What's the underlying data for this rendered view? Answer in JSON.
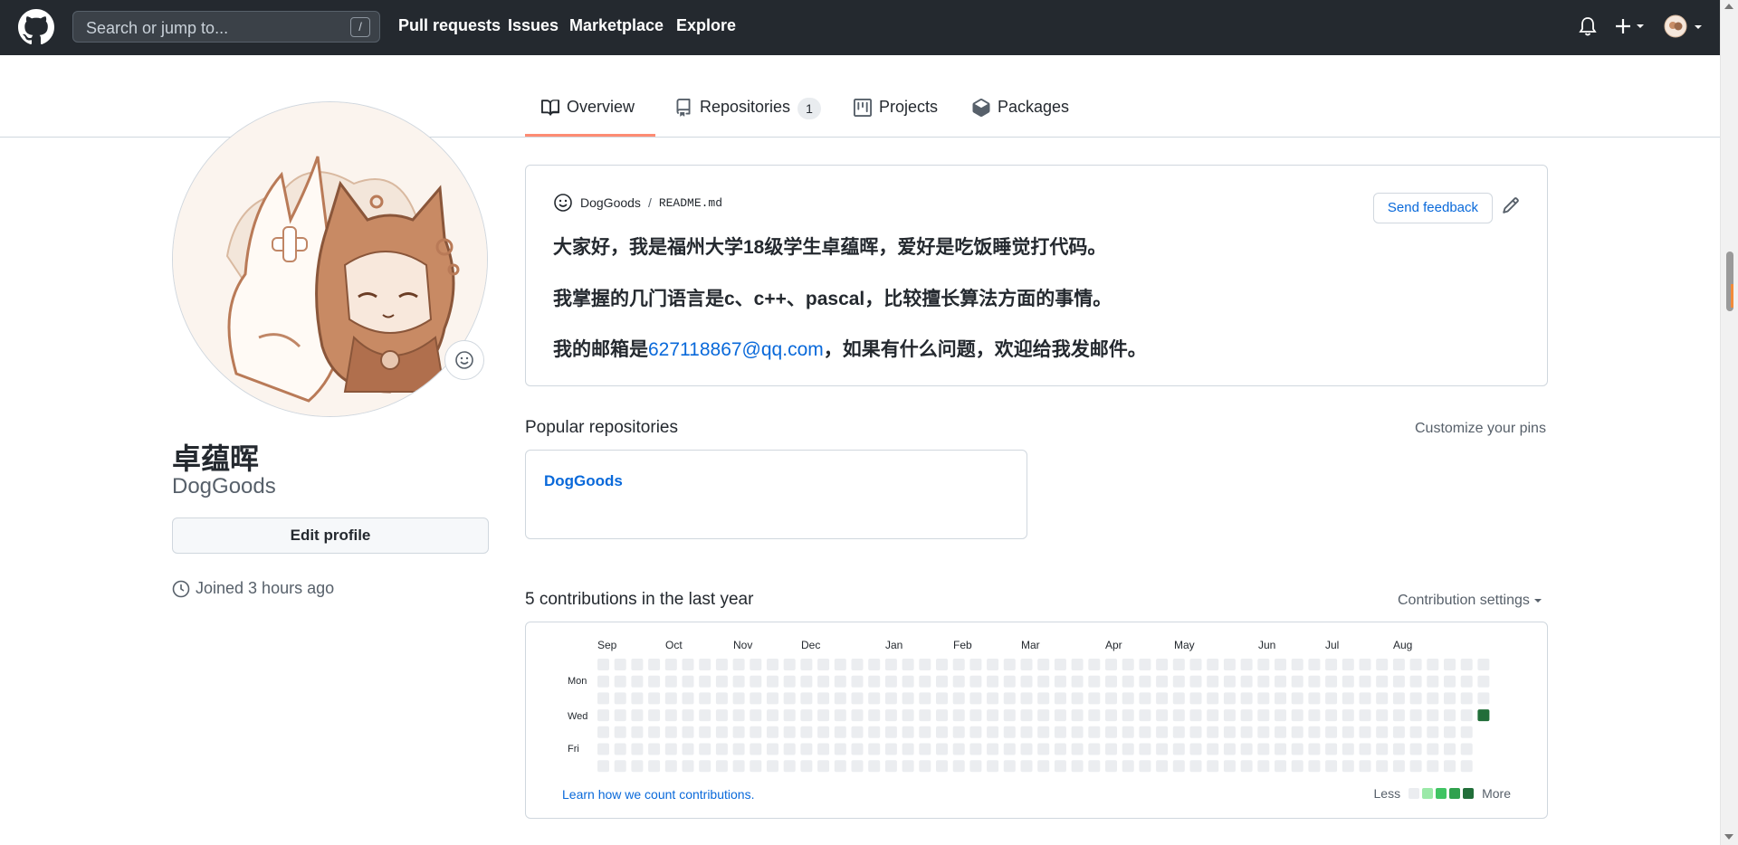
{
  "header": {
    "search_placeholder": "Search or jump to...",
    "search_shortcut": "/",
    "nav": [
      "Pull requests",
      "Issues",
      "Marketplace",
      "Explore"
    ]
  },
  "tabs": [
    {
      "label": "Overview",
      "active": true
    },
    {
      "label": "Repositories",
      "count": "1"
    },
    {
      "label": "Projects"
    },
    {
      "label": "Packages"
    }
  ],
  "profile": {
    "name": "卓蕴晖",
    "login": "DogGoods",
    "edit_label": "Edit profile",
    "joined": "Joined 3 hours ago"
  },
  "readme": {
    "owner": "DogGoods",
    "separator": "/",
    "file": "README.md",
    "feedback_label": "Send feedback",
    "line1": "大家好，我是福州大学18级学生卓蕴晖，爱好是吃饭睡觉打代码。",
    "line2": "我掌握的几门语言是c、c++、pascal，比较擅长算法方面的事情。",
    "line3_before": "我的邮箱是",
    "line3_link": "627118867@qq.com",
    "line3_after": "，如果有什么问题，欢迎给我发邮件。"
  },
  "popular": {
    "title": "Popular repositories",
    "customize": "Customize your pins",
    "repos": [
      {
        "name": "DogGoods"
      }
    ]
  },
  "contributions": {
    "title": "5 contributions in the last year",
    "settings": "Contribution settings",
    "months": [
      "Sep",
      "Oct",
      "Nov",
      "Dec",
      "Jan",
      "Feb",
      "Mar",
      "Apr",
      "May",
      "Jun",
      "Jul",
      "Aug"
    ],
    "days": [
      "Mon",
      "Wed",
      "Fri"
    ],
    "learn": "Learn how we count contributions.",
    "less": "Less",
    "more": "More",
    "colors": [
      "#ebedf0",
      "#9be9a8",
      "#40c463",
      "#30a14e",
      "#216e39"
    ]
  }
}
